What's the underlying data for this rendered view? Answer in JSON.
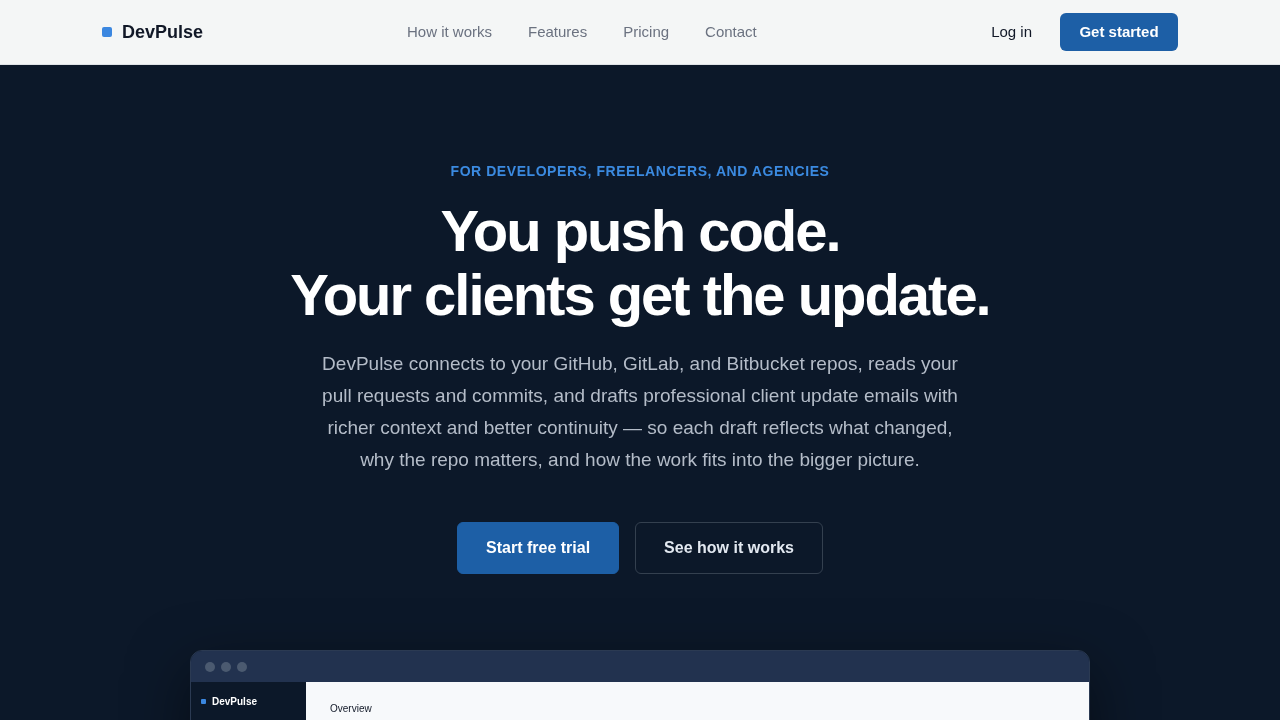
{
  "header": {
    "logo": "DevPulse",
    "nav": [
      "How it works",
      "Features",
      "Pricing",
      "Contact"
    ],
    "login": "Log in",
    "cta": "Get started"
  },
  "hero": {
    "eyebrow": "FOR DEVELOPERS, FREELANCERS, AND AGENCIES",
    "headline": [
      "You push code.",
      "Your clients get the update."
    ],
    "description": "DevPulse connects to your GitHub, GitLab, and Bitbucket repos, reads your pull requests and commits, and drafts professional client update emails with richer context and better continuity — so each draft reflects what changed, why the repo matters, and how the work fits into the bigger picture.",
    "buttons": [
      {
        "label": "Start free trial",
        "kind": "primary"
      },
      {
        "label": "See how it works",
        "kind": "secondary"
      }
    ]
  },
  "app_preview": {
    "sidebar": {
      "logo": "DevPulse"
    },
    "main": {
      "title": "Overview"
    }
  }
}
